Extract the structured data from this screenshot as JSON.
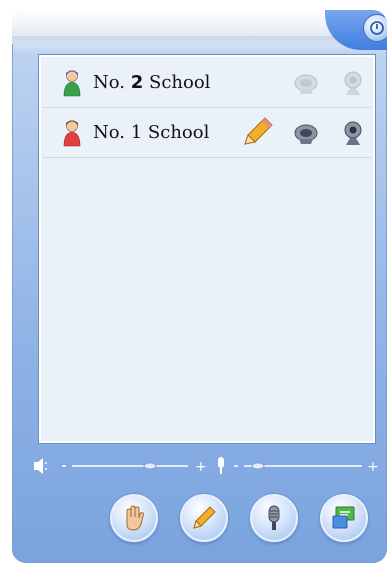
{
  "rows": [
    {
      "label_pre": "No.",
      "num": "2",
      "label_post": "School",
      "active": false
    },
    {
      "label_pre": "No.",
      "num": "1",
      "label_post": "School",
      "active": true
    }
  ],
  "volume": {
    "speaker_plus": "+",
    "mic_plus": "+"
  },
  "icons": {
    "close": "close-icon",
    "user_green": "user-green-icon",
    "user_red": "user-red-icon",
    "pencil": "pencil-icon",
    "speaker": "speaker-icon",
    "camera": "webcam-icon",
    "hand": "raise-hand-icon",
    "mic": "microphone-icon",
    "chat": "chat-icon"
  }
}
